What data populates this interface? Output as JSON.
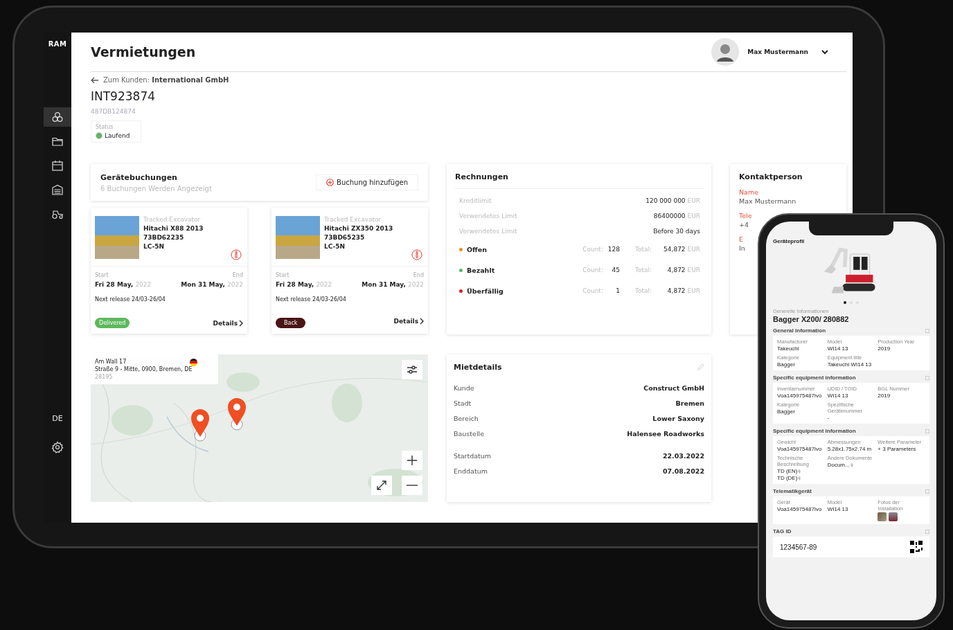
{
  "sidebar": {
    "logo": "RAM",
    "items": [
      {
        "kind": "hexagons",
        "selected": true
      },
      {
        "kind": "folder",
        "selected": false
      },
      {
        "kind": "calendar",
        "selected": false
      },
      {
        "kind": "garage",
        "selected": false
      },
      {
        "kind": "tractor",
        "selected": false
      }
    ],
    "language": "DE"
  },
  "header": {
    "title": "Vermietungen",
    "user": {
      "name": "Max Mustermann"
    }
  },
  "back_link": {
    "label": "Zum Kunden:",
    "customer": "International GmbH"
  },
  "rental": {
    "id": "INT923874",
    "sub_id": "487DB124874",
    "status": {
      "label": "Status",
      "value": "Laufend",
      "color": "#5cb85c"
    }
  },
  "bookings": {
    "title": "Gerätebuchungen",
    "subtitle": "6 Buchungen Werden Angezeigt",
    "add_button": "Buchung hinzufügen",
    "cards": [
      {
        "type": "Tracked Excavator",
        "name": "Hitachi X88 2013",
        "serial": "73BD62235",
        "model": "LC-5N",
        "start_label": "Start",
        "end_label": "End",
        "start_date": "Fri 28 May,",
        "start_year": "2022",
        "end_date": "Mon 31 May,",
        "end_year": "2022",
        "next_release": "Next release 24/03-26/04",
        "status": {
          "kind": "delivered",
          "label": "Delivered"
        },
        "details": "Details"
      },
      {
        "type": "Tracked Excavator",
        "name": "Hitachi ZX350 2013",
        "serial": "73BD65235",
        "model": "LC-5N",
        "start_label": "Start",
        "end_label": "End",
        "start_date": "Fri 28 May,",
        "start_year": "2022",
        "end_date": "Mon 31 May,",
        "end_year": "2022",
        "next_release": "Next release 24/03-26/04",
        "status": {
          "kind": "back",
          "label": "Back"
        },
        "details": "Details"
      }
    ]
  },
  "invoices": {
    "title": "Rechnungen",
    "limits": [
      {
        "label": "Kreditlimit",
        "value": "120 000 000",
        "unit": "EUR"
      },
      {
        "label": "Verwendetes Limit",
        "value": "86400000",
        "unit": "EUR"
      },
      {
        "label": "Verwendetes Limit",
        "value": "Before 30 days"
      }
    ],
    "statuses": [
      {
        "label": "Offen",
        "color": "#f28c1c",
        "count_label": "Count:",
        "count": "128",
        "total_label": "Total:",
        "total": "54,872",
        "unit": "EUR"
      },
      {
        "label": "Bezahlt",
        "color": "#5cb85c",
        "count_label": "Count:",
        "count": "45",
        "total_label": "Total:",
        "total": "4,872",
        "unit": "EUR"
      },
      {
        "label": "Überfällig",
        "color": "#e02020",
        "count_label": "Count:",
        "count": "1",
        "total_label": "Total:",
        "total": "4,872",
        "unit": "EUR"
      }
    ]
  },
  "contact": {
    "title": "Kontaktperson",
    "fields": [
      {
        "label": "Name",
        "value": "Max Mustermann"
      },
      {
        "label": "Tele",
        "value": "+4"
      },
      {
        "label": "E",
        "value": "In"
      }
    ]
  },
  "map": {
    "address": {
      "line1": "Am Wall 17",
      "line2": "Straße 9 - Mitte, 0900, Bremen, DE",
      "postcode": "28195"
    }
  },
  "rental_details": {
    "title": "Mietdetails",
    "groups": [
      {
        "rows": [
          {
            "label": "Kunde",
            "value": "Construct GmbH"
          },
          {
            "label": "Stadt",
            "value": "Bremen"
          },
          {
            "label": "Bereich",
            "value": "Lower Saxony"
          },
          {
            "label": "Baustelle",
            "value": "Halensee Roadworks"
          }
        ]
      },
      {
        "rows": [
          {
            "label": "Startdatum",
            "value": "22.03.2022"
          },
          {
            "label": "Enddatum",
            "value": "07.08.2022"
          }
        ]
      }
    ]
  },
  "phone": {
    "title": "Geräteprofil",
    "carousel": [
      {
        "selected": true
      },
      {
        "selected": false
      },
      {
        "selected": false
      }
    ],
    "caption": "Generelle Informationen",
    "name": "Bagger X200/ 280882",
    "sections": [
      {
        "kind": "fields",
        "title": "General information",
        "fields": [
          {
            "kind": "text",
            "label": "Manufacturer",
            "value": "Takeuchi"
          },
          {
            "kind": "text",
            "label": "Model",
            "value": "WI14 13"
          },
          {
            "kind": "text",
            "label": "Production Year",
            "value": "2019"
          },
          {
            "kind": "text",
            "label": "Kategorie",
            "value": "Bagger"
          },
          {
            "kind": "text",
            "label": "Equipment title",
            "value": "Takeuchi WI14 13"
          }
        ]
      },
      {
        "kind": "fields",
        "title": "Specific equipment information",
        "fields": [
          {
            "kind": "text",
            "label": "Inventarnummer",
            "value": "Voa145975487Ivo"
          },
          {
            "kind": "text",
            "label": "UDID / TOID",
            "value": "WI14 13"
          },
          {
            "kind": "text",
            "label": "BGL Nummer",
            "value": "2019"
          },
          {
            "kind": "text",
            "label": "Kategorie",
            "value": "Bagger"
          },
          {
            "kind": "text",
            "label": "Spezifische Gerätenummer",
            "value": "-"
          }
        ]
      },
      {
        "kind": "fields",
        "title": "Specific equipment information",
        "fields": [
          {
            "kind": "text",
            "label": "Gewicht",
            "value": "Voa145975487Ivo"
          },
          {
            "kind": "text",
            "label": "Abmessungen",
            "value": "5.28x1.75x2.74 m"
          },
          {
            "kind": "text",
            "label": "Weitere Parameter",
            "value": "+ 3 Parameters"
          },
          {
            "kind": "files",
            "label": "Technische Beschreibung",
            "values": [
              "TD (EN)",
              "TD (DE)"
            ]
          },
          {
            "kind": "files",
            "label": "Andere Dokumente",
            "values": [
              "Docum..."
            ]
          }
        ]
      },
      {
        "kind": "fields",
        "title": "Telematikgerät",
        "fields": [
          {
            "kind": "text",
            "label": "Gerät",
            "value": "Voa145975487Ivo"
          },
          {
            "kind": "text",
            "label": "Model",
            "value": "WI14 13"
          },
          {
            "kind": "photos",
            "label": "Fotos der Installation",
            "thumbnails": [
              {
                "kind": "photo"
              },
              {
                "kind": "photo"
              }
            ]
          }
        ]
      },
      {
        "kind": "tag",
        "title": "TAG ID",
        "value": "1234567-89"
      }
    ]
  }
}
